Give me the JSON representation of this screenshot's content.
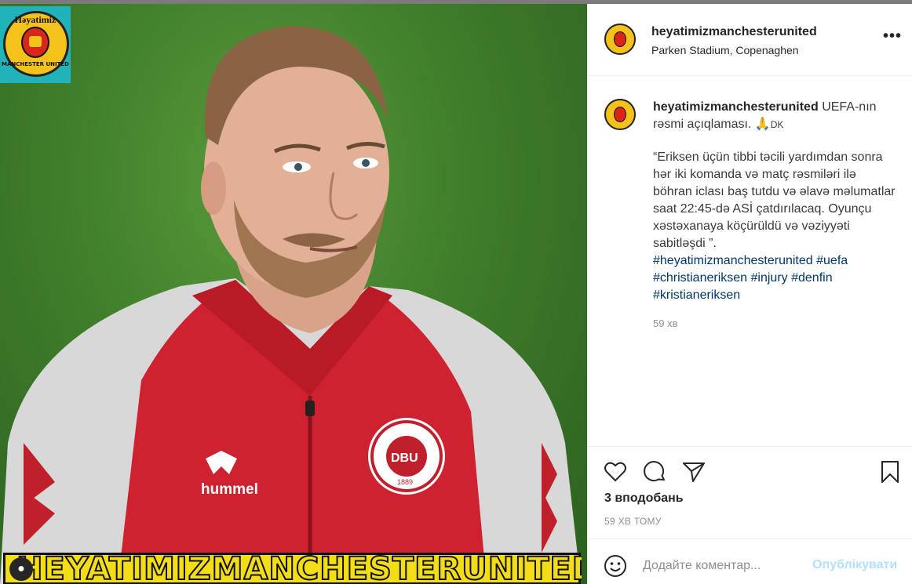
{
  "post_image": {
    "logo_top_text": "Həyatimiz",
    "logo_bottom_text": "MANCHESTER UNITED",
    "banner_text": "HEYATIMIZMANCHESTERUNITED",
    "shirt_brand": "hummel",
    "badge_text": "DBU",
    "badge_ring_text": "DANSK BOLDSPIL-UNION",
    "badge_year": "1889"
  },
  "header": {
    "username": "heyatimizmanchesterunited",
    "location": "Parken Stadium, Copenaghen",
    "more_icon": "ellipsis-icon"
  },
  "caption": {
    "username": "heyatimizmanchesterunited",
    "intro": "UEFA-nın rəsmi açıqlaması. 🙏",
    "intro_suffix": "DK",
    "body": "“Eriksen üçün tibbi təcili yardımdan sonra hər iki komanda və matç rəsmiləri ilə böhran iclası baş tutdu və əlavə məlumatlar saat 22:45-də ASİ çatdırılacaq. Oyunçu xəstəxanaya köçürüldü və vəziyyəti sabitləşdi ”.",
    "hashtags": [
      "#heyatimizmanchesterunited",
      "#uefa",
      "#christianeriksen",
      "#injury",
      "#denfin",
      "#kristianeriksen"
    ],
    "time": "59 хв"
  },
  "actions": {
    "like_icon": "heart-icon",
    "comment_icon": "comment-icon",
    "share_icon": "send-icon",
    "save_icon": "bookmark-icon"
  },
  "likes": "3 вподобань",
  "posted_ago": "59 ХВ ТОМУ",
  "comment": {
    "emoji_icon": "emoji-icon",
    "placeholder": "Додайте коментар...",
    "publish_label": "Опублікувати"
  },
  "colors": {
    "link": "#00376b",
    "publish_disabled": "#b2dffc",
    "secondary_text": "#8e8e8e"
  }
}
